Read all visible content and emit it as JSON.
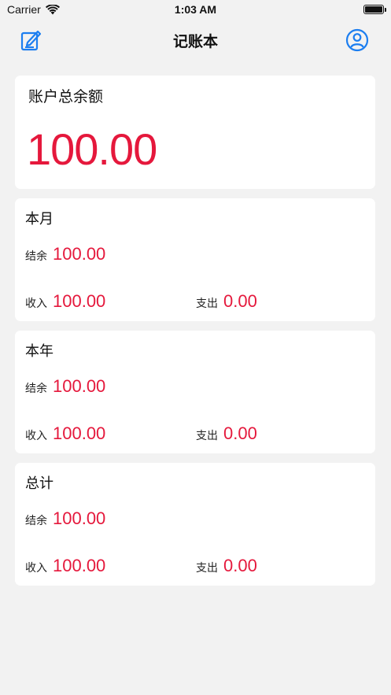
{
  "status": {
    "carrier": "Carrier",
    "time": "1:03 AM",
    "battery_level": 1.0
  },
  "nav": {
    "title": "记账本",
    "left_icon": "edit-icon",
    "right_icon": "user-profile-icon"
  },
  "total": {
    "label": "账户总余额",
    "value": "100.00"
  },
  "colors": {
    "accent_blue": "#1c7ef0",
    "amount_red": "#e5183c",
    "background": "#f2f2f2"
  },
  "stats": [
    {
      "title": "本月",
      "balance_label": "结余",
      "balance": "100.00",
      "income_label": "收入",
      "income": "100.00",
      "expense_label": "支出",
      "expense": "0.00"
    },
    {
      "title": "本年",
      "balance_label": "结余",
      "balance": "100.00",
      "income_label": "收入",
      "income": "100.00",
      "expense_label": "支出",
      "expense": "0.00"
    },
    {
      "title": "总计",
      "balance_label": "结余",
      "balance": "100.00",
      "income_label": "收入",
      "income": "100.00",
      "expense_label": "支出",
      "expense": "0.00"
    }
  ]
}
